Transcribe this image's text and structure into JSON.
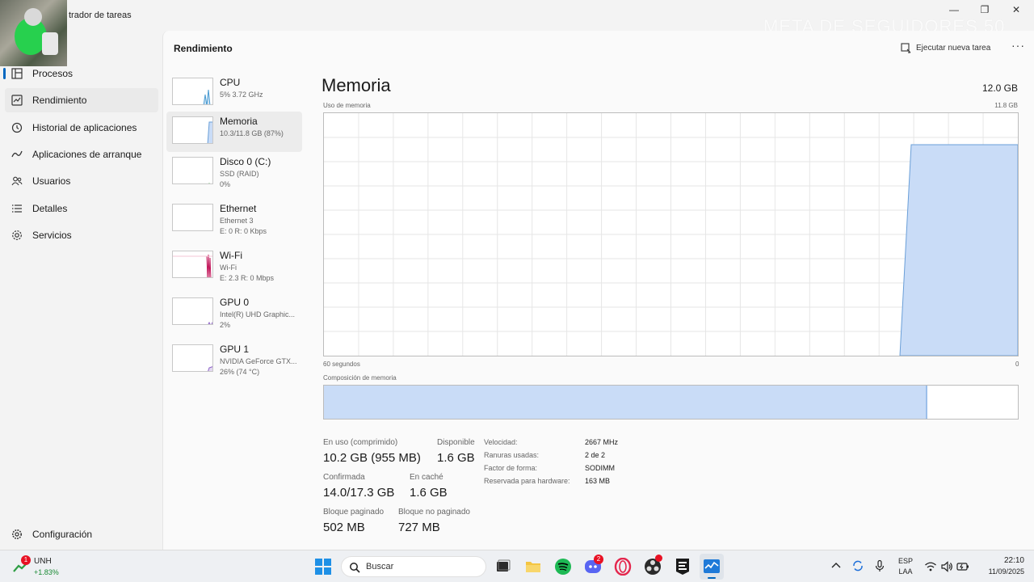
{
  "window": {
    "title": "trador de tareas",
    "watermark": "META DE SEGUIDORES 50",
    "controls": {
      "minimize": "—",
      "maximize": "❐",
      "close": "✕"
    }
  },
  "sidebar": {
    "items": [
      {
        "label": "Procesos",
        "icon": "processes-icon"
      },
      {
        "label": "Rendimiento",
        "icon": "performance-icon"
      },
      {
        "label": "Historial de aplicaciones",
        "icon": "app-history-icon"
      },
      {
        "label": "Aplicaciones de arranque",
        "icon": "startup-apps-icon"
      },
      {
        "label": "Usuarios",
        "icon": "users-icon"
      },
      {
        "label": "Detalles",
        "icon": "details-icon"
      },
      {
        "label": "Servicios",
        "icon": "services-icon"
      }
    ],
    "settings": "Configuración"
  },
  "header": {
    "title": "Rendimiento",
    "run_task": "Ejecutar nueva tarea",
    "more": "···"
  },
  "devices": [
    {
      "name": "CPU",
      "l2": "5% 3.72 GHz",
      "l3": "",
      "color": "#4a9bd1"
    },
    {
      "name": "Memoria",
      "l2": "10.3/11.8 GB (87%)",
      "l3": "",
      "color": "#6a9fd8"
    },
    {
      "name": "Disco 0 (C:)",
      "l2": "SSD (RAID)",
      "l3": "0%",
      "color": "#4caf50"
    },
    {
      "name": "Ethernet",
      "l2": "Ethernet 3",
      "l3": "E: 0 R: 0 Kbps",
      "color": "#a0522d"
    },
    {
      "name": "Wi-Fi",
      "l2": "Wi-Fi",
      "l3": "E: 2.3 R: 0 Mbps",
      "color": "#c2185b"
    },
    {
      "name": "GPU 0",
      "l2": "Intel(R) UHD Graphic...",
      "l3": "2%",
      "color": "#8e63c7"
    },
    {
      "name": "GPU 1",
      "l2": "NVIDIA GeForce GTX...",
      "l3": "26% (74 °C)",
      "color": "#8e63c7"
    }
  ],
  "memory": {
    "title": "Memoria",
    "total": "12.0 GB",
    "usage_label": "Uso de memoria",
    "usage_max": "11.8 GB",
    "time_label": "60 segundos",
    "zero_label": "0",
    "composition_label": "Composición de memoria",
    "composition_in_use_fraction": 0.87,
    "usage_history_fraction": 0.87,
    "colors": {
      "fill": "#c9dcf7",
      "line": "#6a9fd8",
      "grid": "#e6e6e6"
    },
    "stats": {
      "in_use_label": "En uso (comprimido)",
      "in_use_value": "10.2 GB (955 MB)",
      "available_label": "Disponible",
      "available_value": "1.6 GB",
      "committed_label": "Confirmada",
      "committed_value": "14.0/17.3 GB",
      "cached_label": "En caché",
      "cached_value": "1.6 GB",
      "paged_label": "Bloque paginado",
      "paged_value": "502 MB",
      "nonpaged_label": "Bloque no paginado",
      "nonpaged_value": "727 MB"
    },
    "specs": [
      {
        "label": "Velocidad:",
        "value": "2667 MHz"
      },
      {
        "label": "Ranuras usadas:",
        "value": "2 de 2"
      },
      {
        "label": "Factor de forma:",
        "value": "SODIMM"
      },
      {
        "label": "Reservada para hardware:",
        "value": "163 MB"
      }
    ]
  },
  "taskbar": {
    "stock_name": "UNH",
    "stock_change": "+1.83%",
    "stock_badge": "1",
    "search_placeholder": "Buscar",
    "discord_badge": "2",
    "lang_1": "ESP",
    "lang_2": "LAA",
    "time": "22:10",
    "date": "11/09/2025"
  }
}
